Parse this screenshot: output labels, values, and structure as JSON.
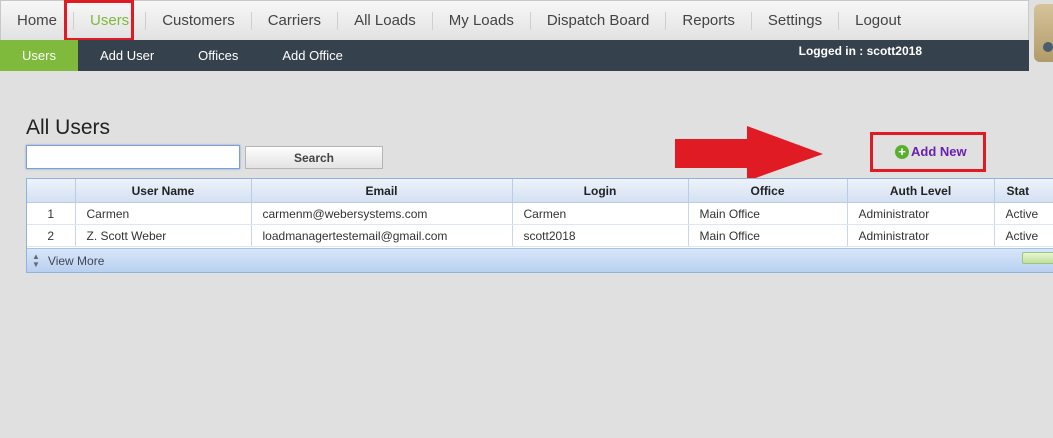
{
  "topnav": {
    "items": [
      "Home",
      "Users",
      "Customers",
      "Carriers",
      "All Loads",
      "My Loads",
      "Dispatch Board",
      "Reports",
      "Settings",
      "Logout"
    ],
    "active": "Users"
  },
  "subnav": {
    "items": [
      "Users",
      "Add User",
      "Offices",
      "Add Office"
    ],
    "logged_in": "Logged in : scott2018"
  },
  "page": {
    "title": "All Users",
    "search_value": "",
    "search_button": "Search",
    "add_new": "Add New"
  },
  "grid": {
    "columns": [
      "User Name",
      "Email",
      "Login",
      "Office",
      "Auth Level",
      "Stat"
    ],
    "rows": [
      {
        "num": "1",
        "user_name": "Carmen",
        "email": "carmenm@webersystems.com",
        "login": "Carmen",
        "office": "Main Office",
        "auth_level": "Administrator",
        "status": "Active"
      },
      {
        "num": "2",
        "user_name": "Z. Scott Weber",
        "email": "loadmanagertestemail@gmail.com",
        "login": "scott2018",
        "office": "Main Office",
        "auth_level": "Administrator",
        "status": "Active"
      }
    ],
    "view_more": "View More"
  },
  "colors": {
    "accent_green": "#7fba3c",
    "subnav_bg": "#35414c",
    "highlight_red": "#e01b24",
    "add_new_purple": "#6b1fb0"
  }
}
